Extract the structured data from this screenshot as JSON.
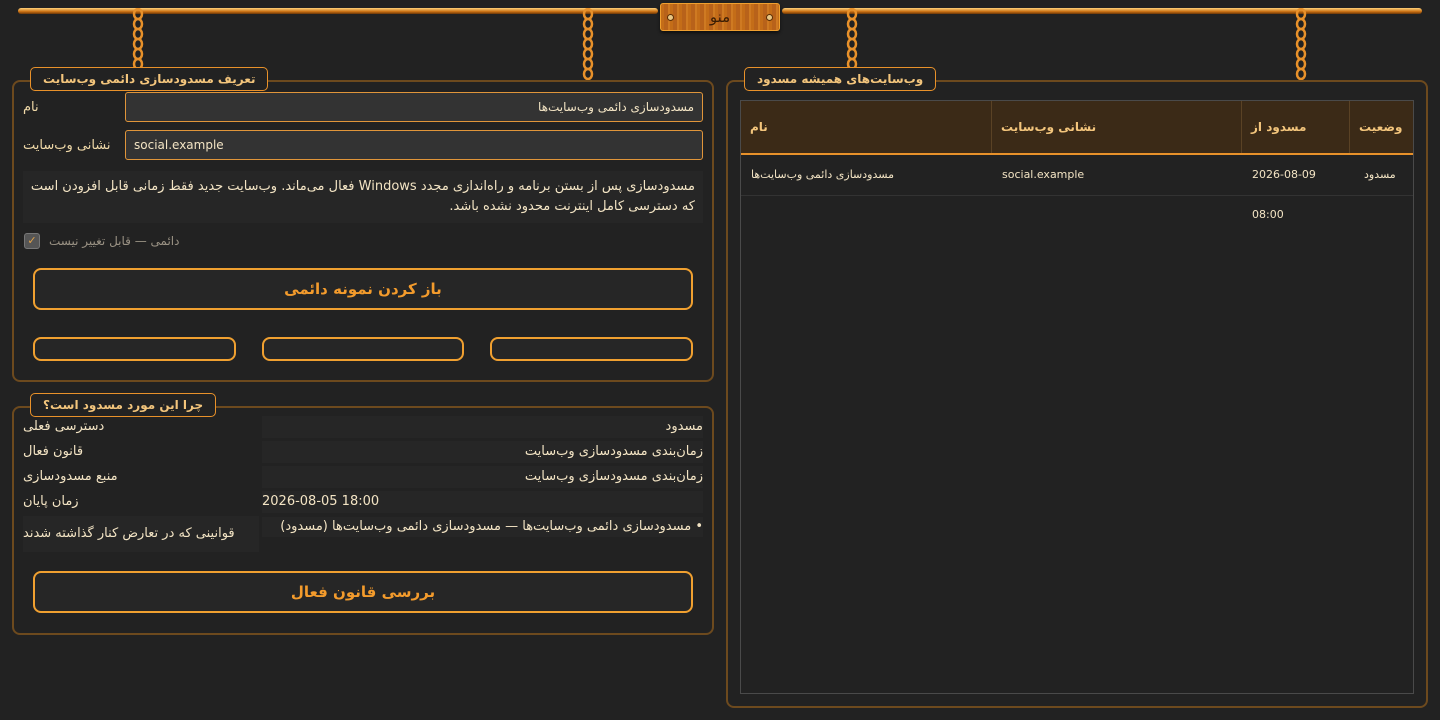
{
  "menu": {
    "label": "منو"
  },
  "definition_panel": {
    "title": "تعریف مسدودسازی دائمی وب‌سایت",
    "name_label": "نام",
    "name_value": "مسدودسازی دائمی وب‌سایت‌ها",
    "url_label": "نشانی وب‌سایت",
    "url_value": "social.example",
    "description": "مسدودسازی پس از بستن برنامه و راه‌اندازی مجدد Windows فعال می‌ماند. وب‌سایت جدید فقط زمانی قابل افزودن است که دسترسی کامل اینترنت محدود نشده باشد.",
    "permanent_checkbox_label": "دائمی — قابل تغییر نیست",
    "permanent_checked": true,
    "open_button": "باز کردن نمونه دائمی"
  },
  "why_panel": {
    "title": "چرا این مورد مسدود است؟",
    "rows": [
      {
        "label": "دسترسی فعلی",
        "value": "مسدود"
      },
      {
        "label": "قانون فعال",
        "value": "زمان‌بندی مسدودسازی وب‌سایت"
      },
      {
        "label": "منبع مسدودسازی",
        "value": "زمان‌بندی مسدودسازی وب‌سایت"
      },
      {
        "label": "زمان پایان",
        "value": "2026-08-05 18:00"
      },
      {
        "label": "قوانینی که در تعارض کنار گذاشته شدند",
        "value": "• مسدودسازی دائمی وب‌سایت‌ها — مسدودسازی دائمی وب‌سایت‌ها (مسدود)"
      }
    ],
    "check_button": "بررسی قانون فعال"
  },
  "sites_panel": {
    "title": "وب‌سایت‌های همیشه مسدود",
    "columns": [
      "نام",
      "نشانی وب‌سایت",
      "مسدود از",
      "وضعیت"
    ],
    "rows": [
      {
        "name": "مسدودسازی دائمی وب‌سایت‌ها",
        "url": "social.example",
        "since": "2026-08-09 08:00",
        "status": "مسدود"
      }
    ]
  },
  "colors": {
    "accent": "#f0a030",
    "background": "#222222",
    "header": "#3b2a17"
  }
}
